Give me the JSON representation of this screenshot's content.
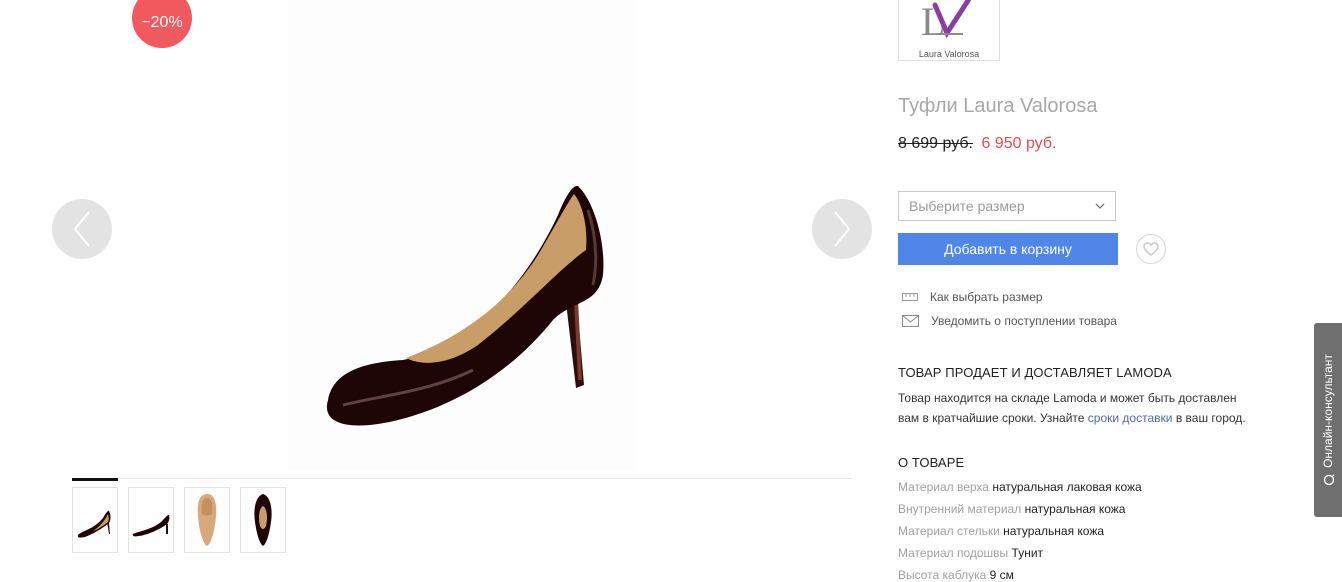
{
  "gallery": {
    "discount_badge": "−20%",
    "thumbnails_count": 4
  },
  "product": {
    "brand_logo_text": "Laura Valorosa",
    "title": "Туфли Laura Valorosa",
    "old_price": "8 699 руб.",
    "new_price": "6 950 руб.",
    "size_select_placeholder": "Выберите размер",
    "add_to_cart_label": "Добавить в корзину",
    "links": {
      "size_guide": "Как выбрать размер",
      "notify": "Уведомить о поступлении товара"
    },
    "delivery": {
      "title": "ТОВАР ПРОДАЕТ И ДОСТАВЛЯЕТ LAMODA",
      "text_line1": "Товар находится на складе Lamoda и может быть доставлен",
      "text_line2_before": "вам в кратчайшие сроки. Узнайте ",
      "link": "сроки доставки",
      "text_line2_after": " в ваш город."
    },
    "about": {
      "title": "О ТОВАРЕ",
      "attributes": [
        {
          "label": "Материал верха",
          "value": "натуральная лаковая кожа"
        },
        {
          "label": "Внутренний материал",
          "value": "натуральная кожа"
        },
        {
          "label": "Материал стельки",
          "value": "натуральная кожа"
        },
        {
          "label": "Материал подошвы",
          "value": "Тунит"
        },
        {
          "label": "Высота каблука",
          "value": "9 см"
        }
      ]
    }
  },
  "consultant": {
    "label": "Онлайн-консультант"
  },
  "colors": {
    "accent_blue": "#4f86e8",
    "sale_red": "#e54b4b",
    "badge_red": "#f05a5f",
    "muted_gray": "#a0a0a0"
  },
  "icons": [
    "chevron-left-icon",
    "chevron-right-icon",
    "chevron-down-icon",
    "heart-icon",
    "ruler-icon",
    "envelope-icon",
    "chat-icon"
  ]
}
